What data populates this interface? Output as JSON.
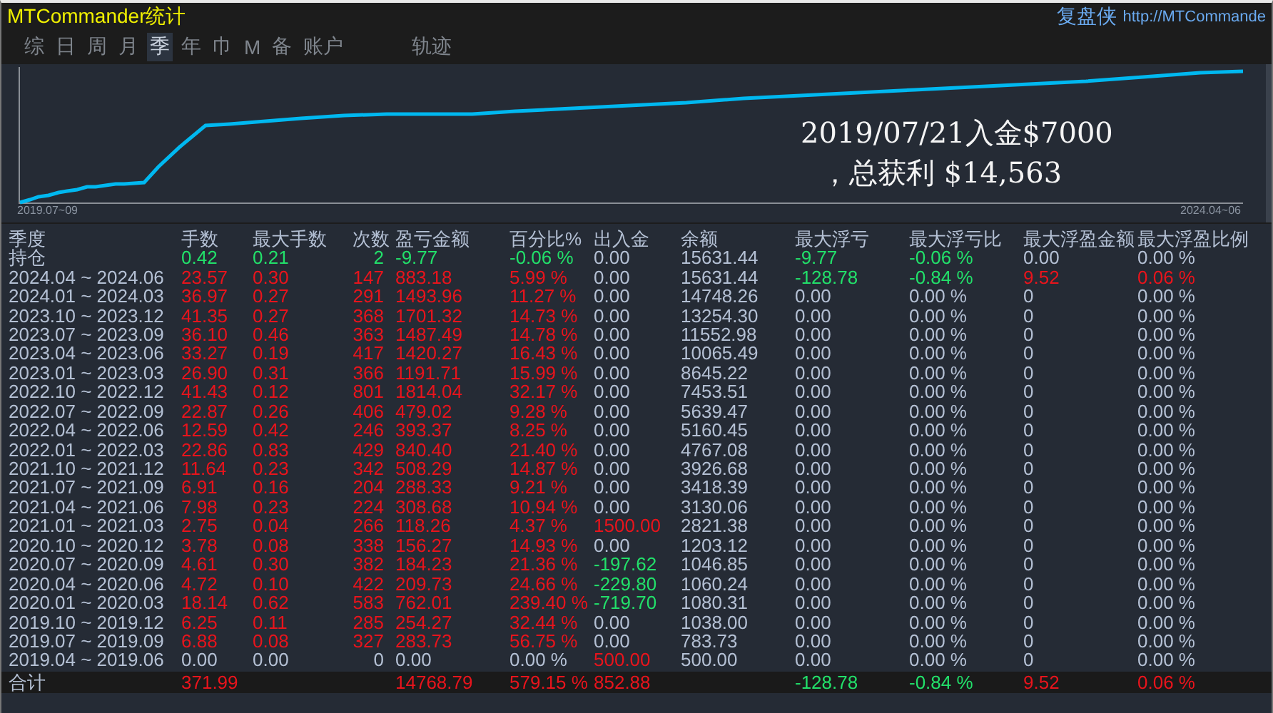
{
  "window": {
    "title": "MTCommander统计",
    "brand": "复盘侠",
    "url": "http://MTCommande"
  },
  "tabs": [
    {
      "label": "综",
      "selected": false
    },
    {
      "label": "日",
      "selected": false
    },
    {
      "label": "周",
      "selected": false
    },
    {
      "label": "月",
      "selected": false
    },
    {
      "label": "季",
      "selected": true
    },
    {
      "label": "年",
      "selected": false
    },
    {
      "label": "巾",
      "selected": false
    },
    {
      "label": "M",
      "selected": false
    },
    {
      "label": "备",
      "selected": false
    },
    {
      "label": "账户",
      "selected": false
    }
  ],
  "track_button": {
    "label": "轨迹"
  },
  "chart": {
    "start_label": "2019.07~09",
    "end_label": "2024.04~06",
    "annotation": [
      "2019/07/21入金$7000",
      "，总获利 $14,563"
    ]
  },
  "table": {
    "columns": [
      "季度",
      "手数",
      "最大手数",
      "次数",
      "盈亏金额",
      "百分比%",
      "出入金",
      "余额",
      "最大浮亏",
      "最大浮亏比",
      "最大浮盈金额",
      "最大浮盈比例"
    ],
    "rows": [
      {
        "cells": [
          {
            "text": "持仓",
            "color": "#b4c0d4"
          },
          {
            "text": "0.42",
            "color": "#22e06a"
          },
          {
            "text": "0.21",
            "color": "#22e06a"
          },
          {
            "text": "2",
            "color": "#22e06a"
          },
          {
            "text": "-9.77",
            "color": "#22e06a"
          },
          {
            "text": "-0.06 %",
            "color": "#22e06a"
          },
          {
            "text": "0.00",
            "color": "#b4c0d4"
          },
          {
            "text": "15631.44",
            "color": "#b4c0d4"
          },
          {
            "text": "-9.77",
            "color": "#22e06a"
          },
          {
            "text": "-0.06 %",
            "color": "#22e06a"
          },
          {
            "text": "0.00",
            "color": "#b4c0d4"
          },
          {
            "text": "0.00 %",
            "color": "#b4c0d4"
          }
        ]
      },
      {
        "cells": [
          {
            "text": "2024.04 ~ 2024.06",
            "color": "#b4c0d4"
          },
          {
            "text": "23.57",
            "color": "#e8141c"
          },
          {
            "text": "0.30",
            "color": "#e8141c"
          },
          {
            "text": "147",
            "color": "#e8141c"
          },
          {
            "text": "883.18",
            "color": "#e8141c"
          },
          {
            "text": "5.99 %",
            "color": "#e8141c"
          },
          {
            "text": "0.00",
            "color": "#b4c0d4"
          },
          {
            "text": "15631.44",
            "color": "#b4c0d4"
          },
          {
            "text": "-128.78",
            "color": "#22e06a"
          },
          {
            "text": "-0.84 %",
            "color": "#22e06a"
          },
          {
            "text": "9.52",
            "color": "#e8141c"
          },
          {
            "text": "0.06 %",
            "color": "#e8141c"
          }
        ]
      },
      {
        "cells": [
          {
            "text": "2024.01 ~ 2024.03",
            "color": "#b4c0d4"
          },
          {
            "text": "36.97",
            "color": "#e8141c"
          },
          {
            "text": "0.27",
            "color": "#e8141c"
          },
          {
            "text": "291",
            "color": "#e8141c"
          },
          {
            "text": "1493.96",
            "color": "#e8141c"
          },
          {
            "text": "11.27 %",
            "color": "#e8141c"
          },
          {
            "text": "0.00",
            "color": "#b4c0d4"
          },
          {
            "text": "14748.26",
            "color": "#b4c0d4"
          },
          {
            "text": "0.00",
            "color": "#b4c0d4"
          },
          {
            "text": "0.00 %",
            "color": "#b4c0d4"
          },
          {
            "text": "0",
            "color": "#b4c0d4"
          },
          {
            "text": "0.00 %",
            "color": "#b4c0d4"
          }
        ]
      },
      {
        "cells": [
          {
            "text": "2023.10 ~ 2023.12",
            "color": "#b4c0d4"
          },
          {
            "text": "41.35",
            "color": "#e8141c"
          },
          {
            "text": "0.27",
            "color": "#e8141c"
          },
          {
            "text": "368",
            "color": "#e8141c"
          },
          {
            "text": "1701.32",
            "color": "#e8141c"
          },
          {
            "text": "14.73 %",
            "color": "#e8141c"
          },
          {
            "text": "0.00",
            "color": "#b4c0d4"
          },
          {
            "text": "13254.30",
            "color": "#b4c0d4"
          },
          {
            "text": "0.00",
            "color": "#b4c0d4"
          },
          {
            "text": "0.00 %",
            "color": "#b4c0d4"
          },
          {
            "text": "0",
            "color": "#b4c0d4"
          },
          {
            "text": "0.00 %",
            "color": "#b4c0d4"
          }
        ]
      },
      {
        "cells": [
          {
            "text": "2023.07 ~ 2023.09",
            "color": "#b4c0d4"
          },
          {
            "text": "36.10",
            "color": "#e8141c"
          },
          {
            "text": "0.46",
            "color": "#e8141c"
          },
          {
            "text": "363",
            "color": "#e8141c"
          },
          {
            "text": "1487.49",
            "color": "#e8141c"
          },
          {
            "text": "14.78 %",
            "color": "#e8141c"
          },
          {
            "text": "0.00",
            "color": "#b4c0d4"
          },
          {
            "text": "11552.98",
            "color": "#b4c0d4"
          },
          {
            "text": "0.00",
            "color": "#b4c0d4"
          },
          {
            "text": "0.00 %",
            "color": "#b4c0d4"
          },
          {
            "text": "0",
            "color": "#b4c0d4"
          },
          {
            "text": "0.00 %",
            "color": "#b4c0d4"
          }
        ]
      },
      {
        "cells": [
          {
            "text": "2023.04 ~ 2023.06",
            "color": "#b4c0d4"
          },
          {
            "text": "33.27",
            "color": "#e8141c"
          },
          {
            "text": "0.19",
            "color": "#e8141c"
          },
          {
            "text": "417",
            "color": "#e8141c"
          },
          {
            "text": "1420.27",
            "color": "#e8141c"
          },
          {
            "text": "16.43 %",
            "color": "#e8141c"
          },
          {
            "text": "0.00",
            "color": "#b4c0d4"
          },
          {
            "text": "10065.49",
            "color": "#b4c0d4"
          },
          {
            "text": "0.00",
            "color": "#b4c0d4"
          },
          {
            "text": "0.00 %",
            "color": "#b4c0d4"
          },
          {
            "text": "0",
            "color": "#b4c0d4"
          },
          {
            "text": "0.00 %",
            "color": "#b4c0d4"
          }
        ]
      },
      {
        "cells": [
          {
            "text": "2023.01 ~ 2023.03",
            "color": "#b4c0d4"
          },
          {
            "text": "26.90",
            "color": "#e8141c"
          },
          {
            "text": "0.31",
            "color": "#e8141c"
          },
          {
            "text": "366",
            "color": "#e8141c"
          },
          {
            "text": "1191.71",
            "color": "#e8141c"
          },
          {
            "text": "15.99 %",
            "color": "#e8141c"
          },
          {
            "text": "0.00",
            "color": "#b4c0d4"
          },
          {
            "text": "8645.22",
            "color": "#b4c0d4"
          },
          {
            "text": "0.00",
            "color": "#b4c0d4"
          },
          {
            "text": "0.00 %",
            "color": "#b4c0d4"
          },
          {
            "text": "0",
            "color": "#b4c0d4"
          },
          {
            "text": "0.00 %",
            "color": "#b4c0d4"
          }
        ]
      },
      {
        "cells": [
          {
            "text": "2022.10 ~ 2022.12",
            "color": "#b4c0d4"
          },
          {
            "text": "41.43",
            "color": "#e8141c"
          },
          {
            "text": "0.12",
            "color": "#e8141c"
          },
          {
            "text": "801",
            "color": "#e8141c"
          },
          {
            "text": "1814.04",
            "color": "#e8141c"
          },
          {
            "text": "32.17 %",
            "color": "#e8141c"
          },
          {
            "text": "0.00",
            "color": "#b4c0d4"
          },
          {
            "text": "7453.51",
            "color": "#b4c0d4"
          },
          {
            "text": "0.00",
            "color": "#b4c0d4"
          },
          {
            "text": "0.00 %",
            "color": "#b4c0d4"
          },
          {
            "text": "0",
            "color": "#b4c0d4"
          },
          {
            "text": "0.00 %",
            "color": "#b4c0d4"
          }
        ]
      },
      {
        "cells": [
          {
            "text": "2022.07 ~ 2022.09",
            "color": "#b4c0d4"
          },
          {
            "text": "22.87",
            "color": "#e8141c"
          },
          {
            "text": "0.26",
            "color": "#e8141c"
          },
          {
            "text": "406",
            "color": "#e8141c"
          },
          {
            "text": "479.02",
            "color": "#e8141c"
          },
          {
            "text": "9.28 %",
            "color": "#e8141c"
          },
          {
            "text": "0.00",
            "color": "#b4c0d4"
          },
          {
            "text": "5639.47",
            "color": "#b4c0d4"
          },
          {
            "text": "0.00",
            "color": "#b4c0d4"
          },
          {
            "text": "0.00 %",
            "color": "#b4c0d4"
          },
          {
            "text": "0",
            "color": "#b4c0d4"
          },
          {
            "text": "0.00 %",
            "color": "#b4c0d4"
          }
        ]
      },
      {
        "cells": [
          {
            "text": "2022.04 ~ 2022.06",
            "color": "#b4c0d4"
          },
          {
            "text": "12.59",
            "color": "#e8141c"
          },
          {
            "text": "0.42",
            "color": "#e8141c"
          },
          {
            "text": "246",
            "color": "#e8141c"
          },
          {
            "text": "393.37",
            "color": "#e8141c"
          },
          {
            "text": "8.25 %",
            "color": "#e8141c"
          },
          {
            "text": "0.00",
            "color": "#b4c0d4"
          },
          {
            "text": "5160.45",
            "color": "#b4c0d4"
          },
          {
            "text": "0.00",
            "color": "#b4c0d4"
          },
          {
            "text": "0.00 %",
            "color": "#b4c0d4"
          },
          {
            "text": "0",
            "color": "#b4c0d4"
          },
          {
            "text": "0.00 %",
            "color": "#b4c0d4"
          }
        ]
      },
      {
        "cells": [
          {
            "text": "2022.01 ~ 2022.03",
            "color": "#b4c0d4"
          },
          {
            "text": "22.86",
            "color": "#e8141c"
          },
          {
            "text": "0.83",
            "color": "#e8141c"
          },
          {
            "text": "429",
            "color": "#e8141c"
          },
          {
            "text": "840.40",
            "color": "#e8141c"
          },
          {
            "text": "21.40 %",
            "color": "#e8141c"
          },
          {
            "text": "0.00",
            "color": "#b4c0d4"
          },
          {
            "text": "4767.08",
            "color": "#b4c0d4"
          },
          {
            "text": "0.00",
            "color": "#b4c0d4"
          },
          {
            "text": "0.00 %",
            "color": "#b4c0d4"
          },
          {
            "text": "0",
            "color": "#b4c0d4"
          },
          {
            "text": "0.00 %",
            "color": "#b4c0d4"
          }
        ]
      },
      {
        "cells": [
          {
            "text": "2021.10 ~ 2021.12",
            "color": "#b4c0d4"
          },
          {
            "text": "11.64",
            "color": "#e8141c"
          },
          {
            "text": "0.23",
            "color": "#e8141c"
          },
          {
            "text": "342",
            "color": "#e8141c"
          },
          {
            "text": "508.29",
            "color": "#e8141c"
          },
          {
            "text": "14.87 %",
            "color": "#e8141c"
          },
          {
            "text": "0.00",
            "color": "#b4c0d4"
          },
          {
            "text": "3926.68",
            "color": "#b4c0d4"
          },
          {
            "text": "0.00",
            "color": "#b4c0d4"
          },
          {
            "text": "0.00 %",
            "color": "#b4c0d4"
          },
          {
            "text": "0",
            "color": "#b4c0d4"
          },
          {
            "text": "0.00 %",
            "color": "#b4c0d4"
          }
        ]
      },
      {
        "cells": [
          {
            "text": "2021.07 ~ 2021.09",
            "color": "#b4c0d4"
          },
          {
            "text": "6.91",
            "color": "#e8141c"
          },
          {
            "text": "0.16",
            "color": "#e8141c"
          },
          {
            "text": "204",
            "color": "#e8141c"
          },
          {
            "text": "288.33",
            "color": "#e8141c"
          },
          {
            "text": "9.21 %",
            "color": "#e8141c"
          },
          {
            "text": "0.00",
            "color": "#b4c0d4"
          },
          {
            "text": "3418.39",
            "color": "#b4c0d4"
          },
          {
            "text": "0.00",
            "color": "#b4c0d4"
          },
          {
            "text": "0.00 %",
            "color": "#b4c0d4"
          },
          {
            "text": "0",
            "color": "#b4c0d4"
          },
          {
            "text": "0.00 %",
            "color": "#b4c0d4"
          }
        ]
      },
      {
        "cells": [
          {
            "text": "2021.04 ~ 2021.06",
            "color": "#b4c0d4"
          },
          {
            "text": "7.98",
            "color": "#e8141c"
          },
          {
            "text": "0.23",
            "color": "#e8141c"
          },
          {
            "text": "224",
            "color": "#e8141c"
          },
          {
            "text": "308.68",
            "color": "#e8141c"
          },
          {
            "text": "10.94 %",
            "color": "#e8141c"
          },
          {
            "text": "0.00",
            "color": "#b4c0d4"
          },
          {
            "text": "3130.06",
            "color": "#b4c0d4"
          },
          {
            "text": "0.00",
            "color": "#b4c0d4"
          },
          {
            "text": "0.00 %",
            "color": "#b4c0d4"
          },
          {
            "text": "0",
            "color": "#b4c0d4"
          },
          {
            "text": "0.00 %",
            "color": "#b4c0d4"
          }
        ]
      },
      {
        "cells": [
          {
            "text": "2021.01 ~ 2021.03",
            "color": "#b4c0d4"
          },
          {
            "text": "2.75",
            "color": "#e8141c"
          },
          {
            "text": "0.04",
            "color": "#e8141c"
          },
          {
            "text": "266",
            "color": "#e8141c"
          },
          {
            "text": "118.26",
            "color": "#e8141c"
          },
          {
            "text": "4.37 %",
            "color": "#e8141c"
          },
          {
            "text": "1500.00",
            "color": "#e8141c"
          },
          {
            "text": "2821.38",
            "color": "#b4c0d4"
          },
          {
            "text": "0.00",
            "color": "#b4c0d4"
          },
          {
            "text": "0.00 %",
            "color": "#b4c0d4"
          },
          {
            "text": "0",
            "color": "#b4c0d4"
          },
          {
            "text": "0.00 %",
            "color": "#b4c0d4"
          }
        ]
      },
      {
        "cells": [
          {
            "text": "2020.10 ~ 2020.12",
            "color": "#b4c0d4"
          },
          {
            "text": "3.78",
            "color": "#e8141c"
          },
          {
            "text": "0.08",
            "color": "#e8141c"
          },
          {
            "text": "338",
            "color": "#e8141c"
          },
          {
            "text": "156.27",
            "color": "#e8141c"
          },
          {
            "text": "14.93 %",
            "color": "#e8141c"
          },
          {
            "text": "0.00",
            "color": "#b4c0d4"
          },
          {
            "text": "1203.12",
            "color": "#b4c0d4"
          },
          {
            "text": "0.00",
            "color": "#b4c0d4"
          },
          {
            "text": "0.00 %",
            "color": "#b4c0d4"
          },
          {
            "text": "0",
            "color": "#b4c0d4"
          },
          {
            "text": "0.00 %",
            "color": "#b4c0d4"
          }
        ]
      },
      {
        "cells": [
          {
            "text": "2020.07 ~ 2020.09",
            "color": "#b4c0d4"
          },
          {
            "text": "4.61",
            "color": "#e8141c"
          },
          {
            "text": "0.30",
            "color": "#e8141c"
          },
          {
            "text": "382",
            "color": "#e8141c"
          },
          {
            "text": "184.23",
            "color": "#e8141c"
          },
          {
            "text": "21.36 %",
            "color": "#e8141c"
          },
          {
            "text": "-197.62",
            "color": "#22e06a"
          },
          {
            "text": "1046.85",
            "color": "#b4c0d4"
          },
          {
            "text": "0.00",
            "color": "#b4c0d4"
          },
          {
            "text": "0.00 %",
            "color": "#b4c0d4"
          },
          {
            "text": "0",
            "color": "#b4c0d4"
          },
          {
            "text": "0.00 %",
            "color": "#b4c0d4"
          }
        ]
      },
      {
        "cells": [
          {
            "text": "2020.04 ~ 2020.06",
            "color": "#b4c0d4"
          },
          {
            "text": "4.72",
            "color": "#e8141c"
          },
          {
            "text": "0.10",
            "color": "#e8141c"
          },
          {
            "text": "422",
            "color": "#e8141c"
          },
          {
            "text": "209.73",
            "color": "#e8141c"
          },
          {
            "text": "24.66 %",
            "color": "#e8141c"
          },
          {
            "text": "-229.80",
            "color": "#22e06a"
          },
          {
            "text": "1060.24",
            "color": "#b4c0d4"
          },
          {
            "text": "0.00",
            "color": "#b4c0d4"
          },
          {
            "text": "0.00 %",
            "color": "#b4c0d4"
          },
          {
            "text": "0",
            "color": "#b4c0d4"
          },
          {
            "text": "0.00 %",
            "color": "#b4c0d4"
          }
        ]
      },
      {
        "cells": [
          {
            "text": "2020.01 ~ 2020.03",
            "color": "#b4c0d4"
          },
          {
            "text": "18.14",
            "color": "#e8141c"
          },
          {
            "text": "0.62",
            "color": "#e8141c"
          },
          {
            "text": "583",
            "color": "#e8141c"
          },
          {
            "text": "762.01",
            "color": "#e8141c"
          },
          {
            "text": "239.40 %",
            "color": "#e8141c"
          },
          {
            "text": "-719.70",
            "color": "#22e06a"
          },
          {
            "text": "1080.31",
            "color": "#b4c0d4"
          },
          {
            "text": "0.00",
            "color": "#b4c0d4"
          },
          {
            "text": "0.00 %",
            "color": "#b4c0d4"
          },
          {
            "text": "0",
            "color": "#b4c0d4"
          },
          {
            "text": "0.00 %",
            "color": "#b4c0d4"
          }
        ]
      },
      {
        "cells": [
          {
            "text": "2019.10 ~ 2019.12",
            "color": "#b4c0d4"
          },
          {
            "text": "6.25",
            "color": "#e8141c"
          },
          {
            "text": "0.11",
            "color": "#e8141c"
          },
          {
            "text": "285",
            "color": "#e8141c"
          },
          {
            "text": "254.27",
            "color": "#e8141c"
          },
          {
            "text": "32.44 %",
            "color": "#e8141c"
          },
          {
            "text": "0.00",
            "color": "#b4c0d4"
          },
          {
            "text": "1038.00",
            "color": "#b4c0d4"
          },
          {
            "text": "0.00",
            "color": "#b4c0d4"
          },
          {
            "text": "0.00 %",
            "color": "#b4c0d4"
          },
          {
            "text": "0",
            "color": "#b4c0d4"
          },
          {
            "text": "0.00 %",
            "color": "#b4c0d4"
          }
        ]
      },
      {
        "cells": [
          {
            "text": "2019.07 ~ 2019.09",
            "color": "#b4c0d4"
          },
          {
            "text": "6.88",
            "color": "#e8141c"
          },
          {
            "text": "0.08",
            "color": "#e8141c"
          },
          {
            "text": "327",
            "color": "#e8141c"
          },
          {
            "text": "283.73",
            "color": "#e8141c"
          },
          {
            "text": "56.75 %",
            "color": "#e8141c"
          },
          {
            "text": "0.00",
            "color": "#b4c0d4"
          },
          {
            "text": "783.73",
            "color": "#b4c0d4"
          },
          {
            "text": "0.00",
            "color": "#b4c0d4"
          },
          {
            "text": "0.00 %",
            "color": "#b4c0d4"
          },
          {
            "text": "0",
            "color": "#b4c0d4"
          },
          {
            "text": "0.00 %",
            "color": "#b4c0d4"
          }
        ]
      },
      {
        "cells": [
          {
            "text": "2019.04 ~ 2019.06",
            "color": "#b4c0d4"
          },
          {
            "text": "0.00",
            "color": "#b4c0d4"
          },
          {
            "text": "0.00",
            "color": "#b4c0d4"
          },
          {
            "text": "0",
            "color": "#b4c0d4"
          },
          {
            "text": "0.00",
            "color": "#b4c0d4"
          },
          {
            "text": "0.00 %",
            "color": "#b4c0d4"
          },
          {
            "text": "500.00",
            "color": "#e8141c"
          },
          {
            "text": "500.00",
            "color": "#b4c0d4"
          },
          {
            "text": "0.00",
            "color": "#b4c0d4"
          },
          {
            "text": "0.00 %",
            "color": "#b4c0d4"
          },
          {
            "text": "0",
            "color": "#b4c0d4"
          },
          {
            "text": "0.00 %",
            "color": "#b4c0d4"
          }
        ]
      }
    ],
    "total": {
      "cells": [
        {
          "text": "合计",
          "color": "#b4c0d4"
        },
        {
          "text": "371.99",
          "color": "#e8141c"
        },
        {
          "text": ""
        },
        {
          "text": ""
        },
        {
          "text": "14768.79",
          "color": "#e8141c"
        },
        {
          "text": "579.15 %",
          "color": "#e8141c"
        },
        {
          "text": "852.88",
          "color": "#e8141c"
        },
        {
          "text": ""
        },
        {
          "text": "-128.78",
          "color": "#22e06a"
        },
        {
          "text": "-0.84 %",
          "color": "#22e06a"
        },
        {
          "text": "9.52",
          "color": "#e8141c"
        },
        {
          "text": "0.06 %",
          "color": "#e8141c"
        }
      ]
    }
  }
}
